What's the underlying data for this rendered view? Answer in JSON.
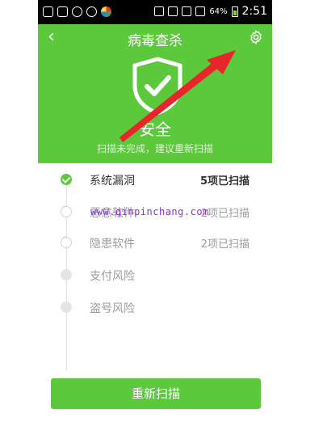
{
  "statusbar": {
    "battery": "64%",
    "time": "2:51"
  },
  "header": {
    "back_icon": "‹",
    "title": "病毒查杀",
    "status": "安全",
    "subtitle": "扫描未完成，建议重新扫描"
  },
  "scan_items": [
    {
      "label": "系统漏洞",
      "status": "5项已扫描",
      "state": "done"
    },
    {
      "label": "恶意软件",
      "status": "2项已扫描",
      "state": "pending"
    },
    {
      "label": "隐患软件",
      "status": "2项已扫描",
      "state": "pending"
    },
    {
      "label": "支付风险",
      "status": "",
      "state": "idle"
    },
    {
      "label": "盗号风险",
      "status": "",
      "state": "idle"
    }
  ],
  "watermark": "www.qinpinchang.com",
  "rescan_button": "重新扫描",
  "colors": {
    "accent": "#5bc93b",
    "arrow": "#e8252b"
  }
}
